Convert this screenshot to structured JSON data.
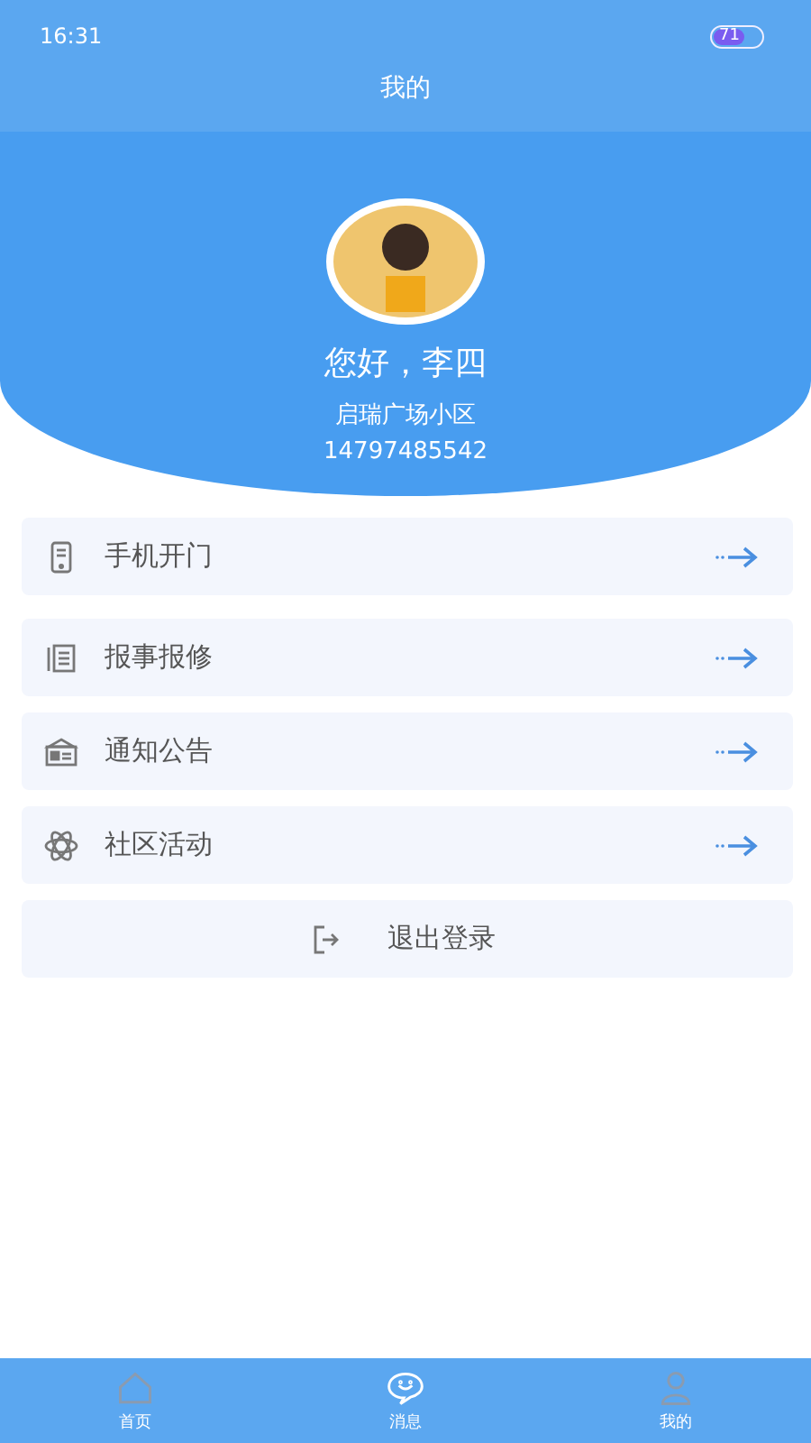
{
  "status_bar": {
    "time": "16:31",
    "battery": "71"
  },
  "title": "我的",
  "profile": {
    "greeting": "您好，李四",
    "community": "启瑞广场小区",
    "phone": "14797485542"
  },
  "menu": [
    {
      "kind": "phone",
      "label": "手机开门"
    },
    {
      "kind": "report",
      "label": "报事报修"
    },
    {
      "kind": "notice",
      "label": "通知公告"
    },
    {
      "kind": "activity",
      "label": "社区活动"
    }
  ],
  "logout": {
    "label": "退出登录"
  },
  "tabs": [
    {
      "kind": "home",
      "label": "首页",
      "selected": false
    },
    {
      "kind": "message",
      "label": "消息",
      "selected": true
    },
    {
      "kind": "me",
      "label": "我的",
      "selected": false
    }
  ]
}
